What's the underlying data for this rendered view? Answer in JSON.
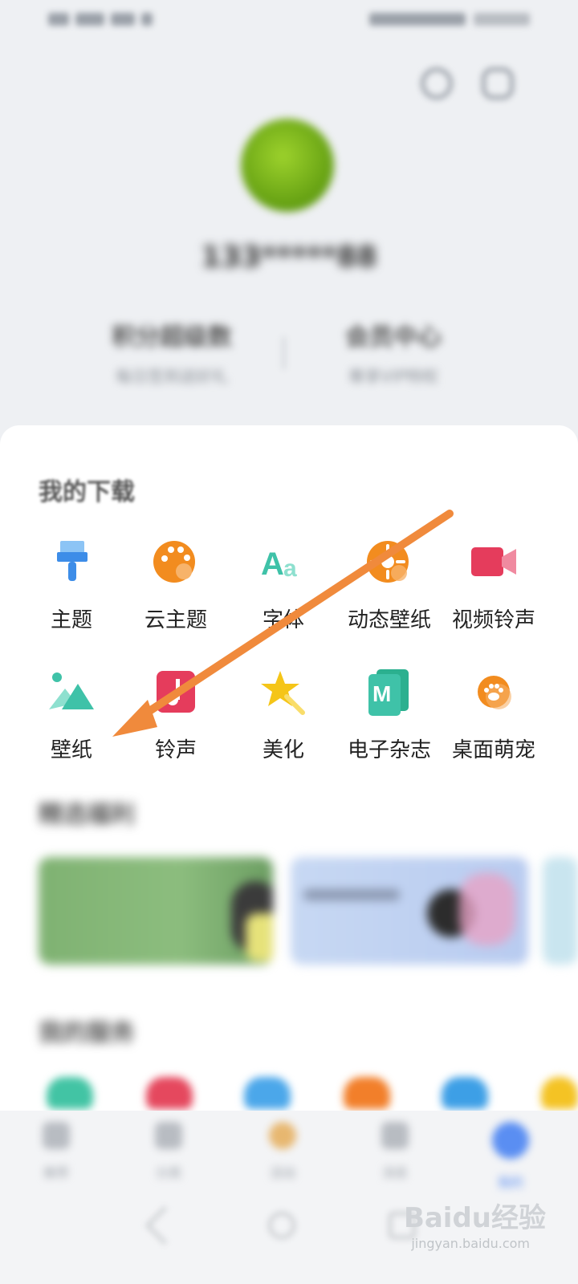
{
  "profile": {
    "user_name": "133*****88",
    "stat_left_title": "积分超级数",
    "stat_left_sub": "每日签到送好礼",
    "stat_right_title": "会员中心",
    "stat_right_sub": "尊享VIP特权"
  },
  "downloads": {
    "title": "我的下载",
    "items": [
      {
        "label": "主题",
        "icon": "brush-icon",
        "color": "#3d8de8"
      },
      {
        "label": "云主题",
        "icon": "palette-icon",
        "color": "#f28c1f"
      },
      {
        "label": "字体",
        "icon": "font-icon",
        "color": "#3fc2a8"
      },
      {
        "label": "动态壁纸",
        "icon": "dynamic-wallpaper-icon",
        "color": "#f28c1f"
      },
      {
        "label": "视频铃声",
        "icon": "video-camera-icon",
        "color": "#e53c5c"
      },
      {
        "label": "壁纸",
        "icon": "mountain-image-icon",
        "color": "#3fc2a8"
      },
      {
        "label": "铃声",
        "icon": "music-note-icon",
        "color": "#e53c5c"
      },
      {
        "label": "美化",
        "icon": "magic-star-icon",
        "color": "#f5c518"
      },
      {
        "label": "电子杂志",
        "icon": "magazine-m-icon",
        "color": "#2bb08f"
      },
      {
        "label": "桌面萌宠",
        "icon": "paw-icon",
        "color": "#f28c1f"
      }
    ]
  },
  "featured": {
    "title": "精选福利"
  },
  "services": {
    "title": "我的服务"
  },
  "nav": {
    "items": [
      {
        "label": "推荐"
      },
      {
        "label": "分类"
      },
      {
        "label": "活动"
      },
      {
        "label": "消息"
      },
      {
        "label": "我的"
      }
    ]
  },
  "watermark": {
    "logo": "Baidu经验",
    "url": "jingyan.baidu.com"
  }
}
